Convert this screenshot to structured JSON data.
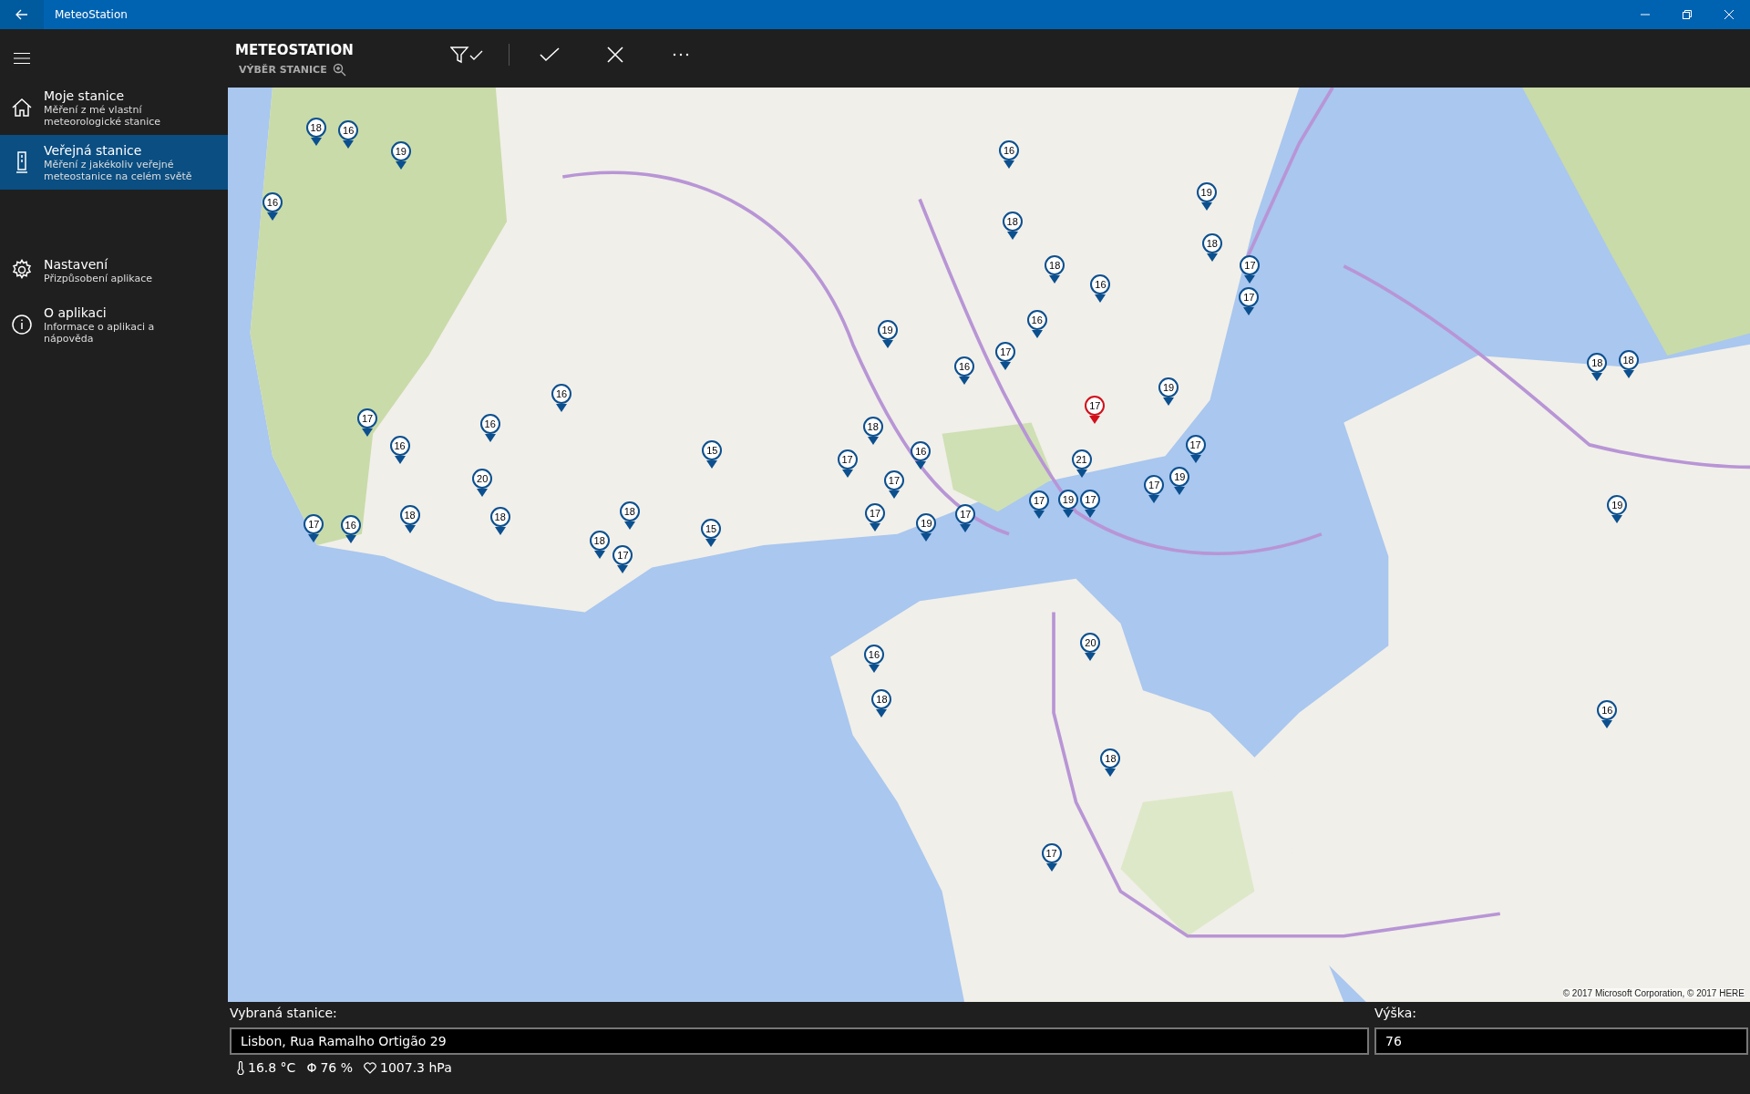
{
  "window": {
    "title": "MeteoStation"
  },
  "sidebar": {
    "items": [
      {
        "kind": "home",
        "title": "Moje stanice",
        "subtitle": "Měření z mé vlastní meteorologické stanice",
        "selected": false
      },
      {
        "kind": "device",
        "title": "Veřejná stanice",
        "subtitle": "Měření z jakékoliv veřejné meteostanice na celém světě",
        "selected": true
      },
      {
        "kind": "gear",
        "title": "Nastavení",
        "subtitle": "Přizpůsobení aplikace",
        "selected": false
      },
      {
        "kind": "info",
        "title": "O aplikaci",
        "subtitle": "Informace o aplikaci a nápověda",
        "selected": false
      }
    ]
  },
  "command_bar": {
    "title": "METEOSTATION",
    "subtitle": "VÝBĚR STANICE"
  },
  "map": {
    "copyright": "© 2017 Microsoft Corporation, © 2017 HERE",
    "pins": [
      {
        "label": "18",
        "selected": false
      },
      {
        "label": "16",
        "selected": false
      },
      {
        "label": "19",
        "selected": false
      },
      {
        "label": "16",
        "selected": false
      },
      {
        "label": "16",
        "selected": false
      },
      {
        "label": "19",
        "selected": false
      },
      {
        "label": "18",
        "selected": false
      },
      {
        "label": "18",
        "selected": false
      },
      {
        "label": "17",
        "selected": false
      },
      {
        "label": "18",
        "selected": false
      },
      {
        "label": "16",
        "selected": false
      },
      {
        "label": "17",
        "selected": false
      },
      {
        "label": "16",
        "selected": false
      },
      {
        "label": "19",
        "selected": false
      },
      {
        "label": "17",
        "selected": false
      },
      {
        "label": "16",
        "selected": false
      },
      {
        "label": "19",
        "selected": false
      },
      {
        "label": "16",
        "selected": false
      },
      {
        "label": "17",
        "selected": false
      },
      {
        "label": "16",
        "selected": false
      },
      {
        "label": "17",
        "selected": true
      },
      {
        "label": "18",
        "selected": false
      },
      {
        "label": "16",
        "selected": false
      },
      {
        "label": "15",
        "selected": false
      },
      {
        "label": "16",
        "selected": false
      },
      {
        "label": "17",
        "selected": false
      },
      {
        "label": "17",
        "selected": false
      },
      {
        "label": "21",
        "selected": false
      },
      {
        "label": "20",
        "selected": false
      },
      {
        "label": "17",
        "selected": false
      },
      {
        "label": "17",
        "selected": false
      },
      {
        "label": "19",
        "selected": false
      },
      {
        "label": "17",
        "selected": false
      },
      {
        "label": "19",
        "selected": false
      },
      {
        "label": "17",
        "selected": false
      },
      {
        "label": "17",
        "selected": false
      },
      {
        "label": "17",
        "selected": false
      },
      {
        "label": "19",
        "selected": false
      },
      {
        "label": "18",
        "selected": false
      },
      {
        "label": "18",
        "selected": false
      },
      {
        "label": "18",
        "selected": false
      },
      {
        "label": "17",
        "selected": false
      },
      {
        "label": "16",
        "selected": false
      },
      {
        "label": "15",
        "selected": false
      },
      {
        "label": "18",
        "selected": false
      },
      {
        "label": "17",
        "selected": false
      },
      {
        "label": "18",
        "selected": false
      },
      {
        "label": "18",
        "selected": false
      },
      {
        "label": "19",
        "selected": false
      },
      {
        "label": "20",
        "selected": false
      },
      {
        "label": "16",
        "selected": false
      },
      {
        "label": "18",
        "selected": false
      },
      {
        "label": "18",
        "selected": false
      },
      {
        "label": "16",
        "selected": false
      },
      {
        "label": "17",
        "selected": false
      }
    ]
  },
  "station": {
    "label": "Vybraná stanice:",
    "value": "Lisbon, Rua Ramalho Ortigão 29"
  },
  "altitude": {
    "label": "Výška:",
    "value": "76"
  },
  "readings": [
    {
      "kind": "thermometer",
      "text": "16.8 °C"
    },
    {
      "kind": "glyph",
      "glyph": "Φ",
      "text": "76 %"
    },
    {
      "kind": "heart",
      "text": "1007.3 hPa"
    }
  ]
}
